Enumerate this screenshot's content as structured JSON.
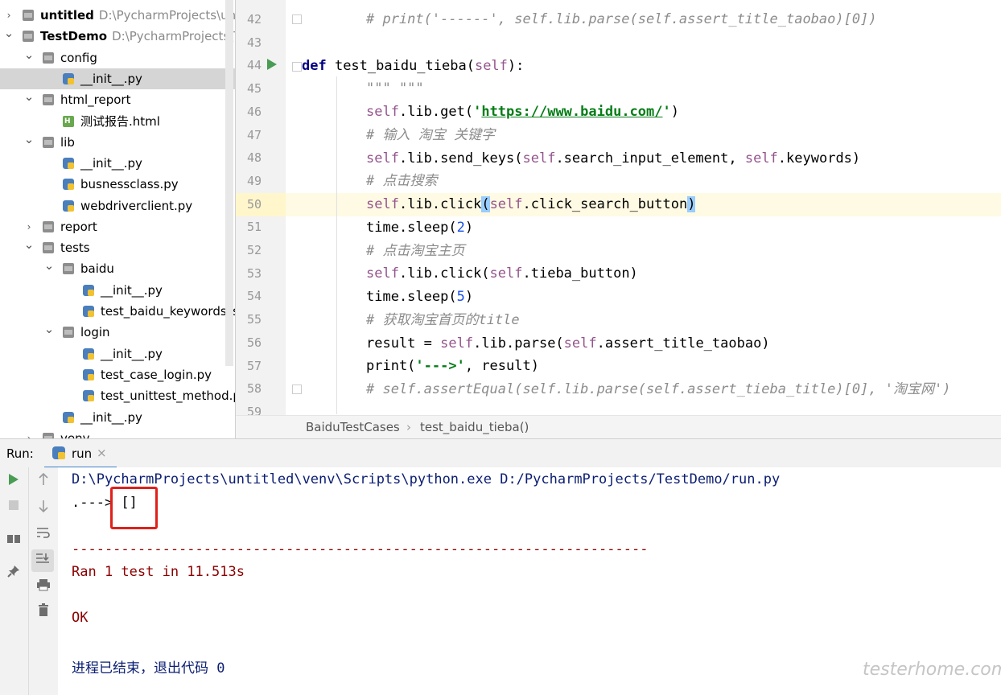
{
  "project_tree": [
    {
      "label": "untitled",
      "path": "D:\\PycharmProjects\\untit",
      "bold": true,
      "expanded": false,
      "type": "folder"
    },
    {
      "label": "TestDemo",
      "path": "D:\\PycharmProjects\\T",
      "bold": true,
      "expanded": true,
      "type": "folder"
    },
    {
      "label": "config",
      "expanded": true,
      "type": "folder"
    },
    {
      "label": "__init__.py",
      "type": "python",
      "selected": true
    },
    {
      "label": "html_report",
      "expanded": true,
      "type": "folder"
    },
    {
      "label": "测试报告.html",
      "type": "html"
    },
    {
      "label": "lib",
      "expanded": true,
      "type": "folder"
    },
    {
      "label": "__init__.py",
      "type": "python"
    },
    {
      "label": "busnessclass.py",
      "type": "python"
    },
    {
      "label": "webdriverclient.py",
      "type": "python"
    },
    {
      "label": "report",
      "expanded": false,
      "type": "folder"
    },
    {
      "label": "tests",
      "expanded": true,
      "type": "folder"
    },
    {
      "label": "baidu",
      "expanded": true,
      "type": "folder"
    },
    {
      "label": "__init__.py",
      "type": "python"
    },
    {
      "label": "test_baidu_keywords_s",
      "type": "python"
    },
    {
      "label": "login",
      "expanded": true,
      "type": "folder"
    },
    {
      "label": "__init__.py",
      "type": "python"
    },
    {
      "label": "test_case_login.py",
      "type": "python"
    },
    {
      "label": "test_unittest_method.p",
      "type": "python"
    },
    {
      "label": "__init__.py",
      "type": "python"
    },
    {
      "label": "venv",
      "type": "folder"
    }
  ],
  "editor": {
    "line_numbers": [
      "42",
      "43",
      "44",
      "45",
      "46",
      "47",
      "48",
      "49",
      "50",
      "51",
      "52",
      "53",
      "54",
      "55",
      "56",
      "57",
      "58",
      "59"
    ],
    "current_line": "50",
    "code": {
      "l42_comment": "# print('------', self.lib.parse(self.assert_title_taobao)[0])",
      "l44_def": "def",
      "l44_name": " test_baidu_tieba(",
      "l44_self": "self",
      "l44_end": "):",
      "l45_doc": "\"\"\" \"\"\"",
      "l46_a": "self",
      "l46_b": ".lib.get(",
      "l46_q1": "'",
      "l46_url": "https://www.baidu.com/",
      "l46_q2": "'",
      "l46_c": ")",
      "l47_comment": "# 输入 淘宝 关键字",
      "l48_a": "self",
      "l48_b": ".lib.send_keys(",
      "l48_c": "self",
      "l48_d": ".search_input_element, ",
      "l48_e": "self",
      "l48_f": ".keywords)",
      "l49_comment": "# 点击搜索",
      "l50_a": "self",
      "l50_b": ".lib.click",
      "l50_p1": "(",
      "l50_c": "self",
      "l50_d": ".click_search_button",
      "l50_p2": ")",
      "l51_a": "time.sleep(",
      "l51_n": "2",
      "l51_b": ")",
      "l52_comment": "# 点击淘宝主页",
      "l53_a": "self",
      "l53_b": ".lib.click(",
      "l53_c": "self",
      "l53_d": ".tieba_button)",
      "l54_a": "time.sleep(",
      "l54_n": "5",
      "l54_b": ")",
      "l55_comment": "# 获取淘宝首页的title",
      "l56_a": "result = ",
      "l56_b": "self",
      "l56_c": ".lib.parse(",
      "l56_d": "self",
      "l56_e": ".assert_title_taobao)",
      "l57_a": "print(",
      "l57_s": "'--->'",
      "l57_b": ", result)",
      "l58_comment": "# self.assertEqual(self.lib.parse(self.assert_tieba_title)[0], '淘宝网')"
    }
  },
  "breadcrumb": {
    "class_name": "BaiduTestCases",
    "separator": "›",
    "method_name": "test_baidu_tieba()"
  },
  "run_panel": {
    "label": "Run:",
    "tab_label": "run",
    "tab_close": "×",
    "console_lines": [
      {
        "text": "D:\\PycharmProjects\\untitled\\venv\\Scripts\\python.exe D:/PycharmProjects/TestDemo/run.py",
        "color": "#0b1e72"
      },
      {
        "text": ".---> []",
        "color": "#000000"
      },
      {
        "text": "",
        "color": "#000000"
      },
      {
        "text": "----------------------------------------------------------------------",
        "color": "#8b0000"
      },
      {
        "text": "Ran 1 test in 11.513s",
        "color": "#8b0000"
      },
      {
        "text": "",
        "color": "#000000"
      },
      {
        "text": "OK",
        "color": "#8b0000"
      },
      {
        "text": "",
        "color": "#000000"
      },
      {
        "text": "进程已结束，退出代码 0",
        "color": "#0b1e72"
      }
    ]
  },
  "watermark": "testerhome.com",
  "colors": {
    "accent": "#4083c9",
    "run_green": "#499c54",
    "highlight_red": "#e0201a",
    "current_line": "#fffae3"
  }
}
